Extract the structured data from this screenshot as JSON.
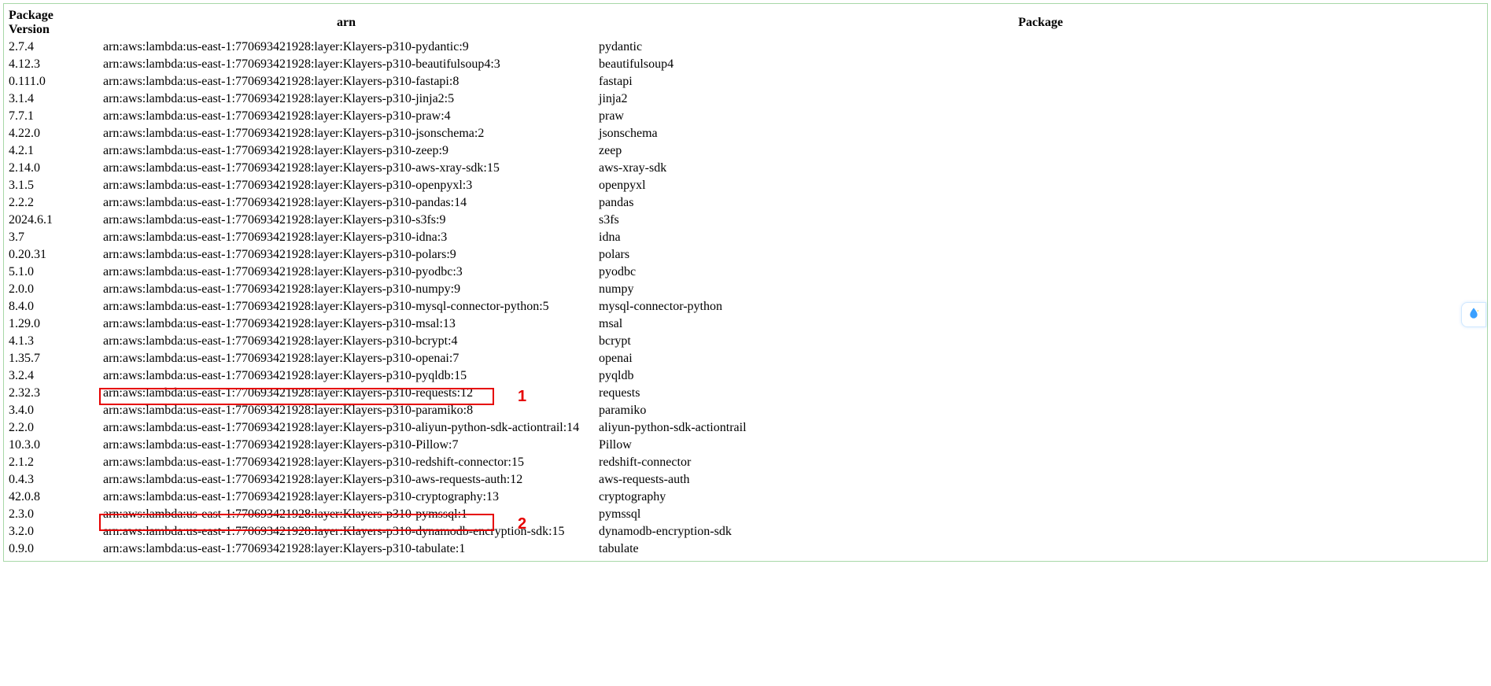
{
  "columns": {
    "version": "Package Version",
    "arn": "arn",
    "package": "Package"
  },
  "rows": [
    {
      "version": "2.7.4",
      "arn": "arn:aws:lambda:us-east-1:770693421928:layer:Klayers-p310-pydantic:9",
      "package": "pydantic"
    },
    {
      "version": "4.12.3",
      "arn": "arn:aws:lambda:us-east-1:770693421928:layer:Klayers-p310-beautifulsoup4:3",
      "package": "beautifulsoup4"
    },
    {
      "version": "0.111.0",
      "arn": "arn:aws:lambda:us-east-1:770693421928:layer:Klayers-p310-fastapi:8",
      "package": "fastapi"
    },
    {
      "version": "3.1.4",
      "arn": "arn:aws:lambda:us-east-1:770693421928:layer:Klayers-p310-jinja2:5",
      "package": "jinja2"
    },
    {
      "version": "7.7.1",
      "arn": "arn:aws:lambda:us-east-1:770693421928:layer:Klayers-p310-praw:4",
      "package": "praw"
    },
    {
      "version": "4.22.0",
      "arn": "arn:aws:lambda:us-east-1:770693421928:layer:Klayers-p310-jsonschema:2",
      "package": "jsonschema"
    },
    {
      "version": "4.2.1",
      "arn": "arn:aws:lambda:us-east-1:770693421928:layer:Klayers-p310-zeep:9",
      "package": "zeep"
    },
    {
      "version": "2.14.0",
      "arn": "arn:aws:lambda:us-east-1:770693421928:layer:Klayers-p310-aws-xray-sdk:15",
      "package": "aws-xray-sdk"
    },
    {
      "version": "3.1.5",
      "arn": "arn:aws:lambda:us-east-1:770693421928:layer:Klayers-p310-openpyxl:3",
      "package": "openpyxl"
    },
    {
      "version": "2.2.2",
      "arn": "arn:aws:lambda:us-east-1:770693421928:layer:Klayers-p310-pandas:14",
      "package": "pandas"
    },
    {
      "version": "2024.6.1",
      "arn": "arn:aws:lambda:us-east-1:770693421928:layer:Klayers-p310-s3fs:9",
      "package": "s3fs"
    },
    {
      "version": "3.7",
      "arn": "arn:aws:lambda:us-east-1:770693421928:layer:Klayers-p310-idna:3",
      "package": "idna"
    },
    {
      "version": "0.20.31",
      "arn": "arn:aws:lambda:us-east-1:770693421928:layer:Klayers-p310-polars:9",
      "package": "polars"
    },
    {
      "version": "5.1.0",
      "arn": "arn:aws:lambda:us-east-1:770693421928:layer:Klayers-p310-pyodbc:3",
      "package": "pyodbc"
    },
    {
      "version": "2.0.0",
      "arn": "arn:aws:lambda:us-east-1:770693421928:layer:Klayers-p310-numpy:9",
      "package": "numpy"
    },
    {
      "version": "8.4.0",
      "arn": "arn:aws:lambda:us-east-1:770693421928:layer:Klayers-p310-mysql-connector-python:5",
      "package": "mysql-connector-python"
    },
    {
      "version": "1.29.0",
      "arn": "arn:aws:lambda:us-east-1:770693421928:layer:Klayers-p310-msal:13",
      "package": "msal"
    },
    {
      "version": "4.1.3",
      "arn": "arn:aws:lambda:us-east-1:770693421928:layer:Klayers-p310-bcrypt:4",
      "package": "bcrypt"
    },
    {
      "version": "1.35.7",
      "arn": "arn:aws:lambda:us-east-1:770693421928:layer:Klayers-p310-openai:7",
      "package": "openai"
    },
    {
      "version": "3.2.4",
      "arn": "arn:aws:lambda:us-east-1:770693421928:layer:Klayers-p310-pyqldb:15",
      "package": "pyqldb"
    },
    {
      "version": "2.32.3",
      "arn": "arn:aws:lambda:us-east-1:770693421928:layer:Klayers-p310-requests:12",
      "package": "requests"
    },
    {
      "version": "3.4.0",
      "arn": "arn:aws:lambda:us-east-1:770693421928:layer:Klayers-p310-paramiko:8",
      "package": "paramiko"
    },
    {
      "version": "2.2.0",
      "arn": "arn:aws:lambda:us-east-1:770693421928:layer:Klayers-p310-aliyun-python-sdk-actiontrail:14",
      "package": "aliyun-python-sdk-actiontrail"
    },
    {
      "version": "10.3.0",
      "arn": "arn:aws:lambda:us-east-1:770693421928:layer:Klayers-p310-Pillow:7",
      "package": "Pillow"
    },
    {
      "version": "2.1.2",
      "arn": "arn:aws:lambda:us-east-1:770693421928:layer:Klayers-p310-redshift-connector:15",
      "package": "redshift-connector"
    },
    {
      "version": "0.4.3",
      "arn": "arn:aws:lambda:us-east-1:770693421928:layer:Klayers-p310-aws-requests-auth:12",
      "package": "aws-requests-auth"
    },
    {
      "version": "42.0.8",
      "arn": "arn:aws:lambda:us-east-1:770693421928:layer:Klayers-p310-cryptography:13",
      "package": "cryptography"
    },
    {
      "version": "2.3.0",
      "arn": "arn:aws:lambda:us-east-1:770693421928:layer:Klayers-p310-pymssql:1",
      "package": "pymssql"
    },
    {
      "version": "3.2.0",
      "arn": "arn:aws:lambda:us-east-1:770693421928:layer:Klayers-p310-dynamodb-encryption-sdk:15",
      "package": "dynamodb-encryption-sdk"
    },
    {
      "version": "0.9.0",
      "arn": "arn:aws:lambda:us-east-1:770693421928:layer:Klayers-p310-tabulate:1",
      "package": "tabulate"
    }
  ],
  "annotations": {
    "label1": "1",
    "label2": "2"
  }
}
